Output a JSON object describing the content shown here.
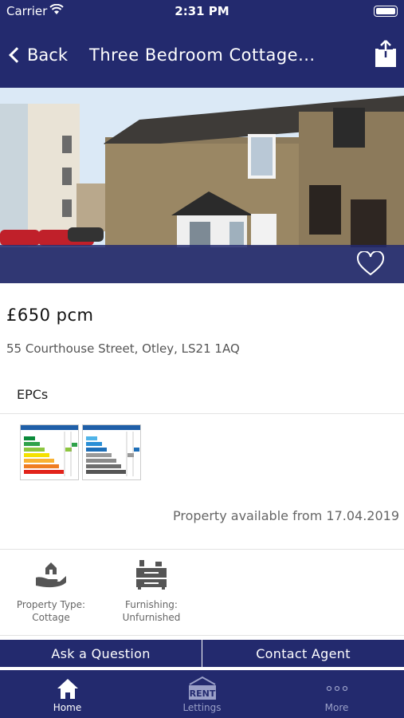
{
  "status_bar": {
    "carrier": "Carrier",
    "time": "2:31 PM"
  },
  "nav": {
    "back_label": "Back",
    "title": "Three Bedroom Cottage..."
  },
  "property": {
    "price": "£650 pcm",
    "address": "55 Courthouse Street, Otley, LS21 1AQ",
    "available": "Property available from 17.04.2019"
  },
  "epc": {
    "header": "EPCs"
  },
  "features": [
    {
      "icon": "house-in-hand-icon",
      "label": "Property Type:",
      "value": "Cottage"
    },
    {
      "icon": "furniture-icon",
      "label": "Furnishing:",
      "value": "Unfurnished"
    }
  ],
  "actions": {
    "ask": "Ask a Question",
    "contact": "Contact Agent"
  },
  "tabs": [
    {
      "label": "Home",
      "icon": "home-icon",
      "active": true
    },
    {
      "label": "Lettings",
      "icon": "rent-sign-icon",
      "active": false
    },
    {
      "label": "More",
      "icon": "more-dots-icon",
      "active": false
    }
  ],
  "colors": {
    "brand": "#232a6e",
    "text_secondary": "#666666"
  }
}
